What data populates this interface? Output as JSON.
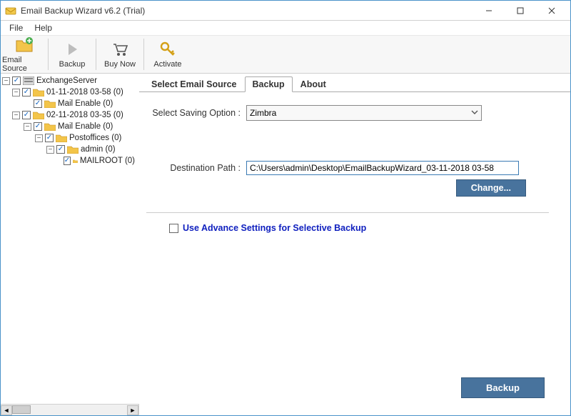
{
  "window": {
    "title": "Email Backup Wizard v6.2 (Trial)"
  },
  "menu": {
    "file": "File",
    "help": "Help"
  },
  "toolbar": {
    "email_source": "Email Source",
    "backup": "Backup",
    "buy_now": "Buy Now",
    "activate": "Activate"
  },
  "tree": {
    "root": "ExchangeServer",
    "n1": "01-11-2018 03-58 (0)",
    "n1a": "Mail Enable (0)",
    "n2": "02-11-2018 03-35 (0)",
    "n2a": "Mail Enable (0)",
    "n2b": "Postoffices (0)",
    "n2c": "admin (0)",
    "n2d": "MAILROOT (0)"
  },
  "tabs": {
    "t1": "Select Email Source",
    "t2": "Backup",
    "t3": "About"
  },
  "form": {
    "saving_label": "Select Saving Option  :",
    "saving_value": "Zimbra",
    "dest_label": "Destination Path  :",
    "dest_value": "C:\\Users\\admin\\Desktop\\EmailBackupWizard_03-11-2018 03-58",
    "change_btn": "Change...",
    "advance_label": "Use Advance Settings for Selective Backup",
    "backup_btn": "Backup"
  }
}
